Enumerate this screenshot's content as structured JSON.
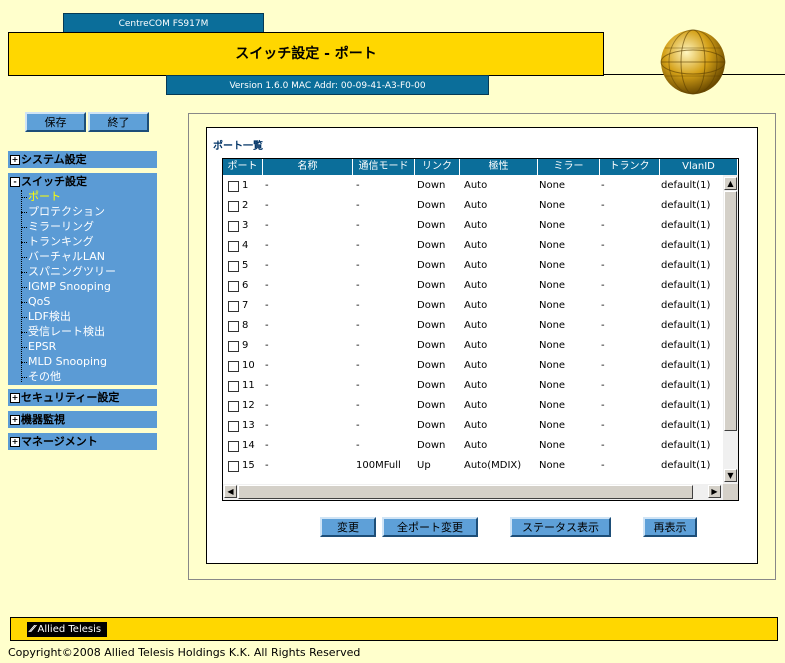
{
  "header": {
    "model": "CentreCOM FS917M",
    "title": "スイッチ設定 - ポート",
    "version": "Version 1.6.0 MAC Addr: 00-09-41-A3-F0-00"
  },
  "actions": {
    "save": "保存",
    "exit": "終了"
  },
  "sidebar": {
    "system": "システム設定",
    "switch": "スイッチ設定",
    "switch_items": [
      "ポート",
      "プロテクション",
      "ミラーリング",
      "トランキング",
      "バーチャルLAN",
      "スパニングツリー",
      "IGMP Snooping",
      "QoS",
      "LDF検出",
      "受信レート検出",
      "EPSR",
      "MLD Snooping",
      "その他"
    ],
    "security": "セキュリティー設定",
    "monitor": "機器監視",
    "management": "マネージメント",
    "expand_glyph": "+",
    "collapse_glyph": "-"
  },
  "port_list": {
    "title": "ポート一覧",
    "columns": [
      "ポート",
      "名称",
      "通信モード",
      "リンク",
      "極性",
      "ミラー",
      "トランク",
      "VlanID"
    ],
    "rows": [
      {
        "port": "1",
        "name": "-",
        "mode": "-",
        "link": "Down",
        "polarity": "Auto",
        "mirror": "None",
        "trunk": "-",
        "vlan": "default(1)"
      },
      {
        "port": "2",
        "name": "-",
        "mode": "-",
        "link": "Down",
        "polarity": "Auto",
        "mirror": "None",
        "trunk": "-",
        "vlan": "default(1)"
      },
      {
        "port": "3",
        "name": "-",
        "mode": "-",
        "link": "Down",
        "polarity": "Auto",
        "mirror": "None",
        "trunk": "-",
        "vlan": "default(1)"
      },
      {
        "port": "4",
        "name": "-",
        "mode": "-",
        "link": "Down",
        "polarity": "Auto",
        "mirror": "None",
        "trunk": "-",
        "vlan": "default(1)"
      },
      {
        "port": "5",
        "name": "-",
        "mode": "-",
        "link": "Down",
        "polarity": "Auto",
        "mirror": "None",
        "trunk": "-",
        "vlan": "default(1)"
      },
      {
        "port": "6",
        "name": "-",
        "mode": "-",
        "link": "Down",
        "polarity": "Auto",
        "mirror": "None",
        "trunk": "-",
        "vlan": "default(1)"
      },
      {
        "port": "7",
        "name": "-",
        "mode": "-",
        "link": "Down",
        "polarity": "Auto",
        "mirror": "None",
        "trunk": "-",
        "vlan": "default(1)"
      },
      {
        "port": "8",
        "name": "-",
        "mode": "-",
        "link": "Down",
        "polarity": "Auto",
        "mirror": "None",
        "trunk": "-",
        "vlan": "default(1)"
      },
      {
        "port": "9",
        "name": "-",
        "mode": "-",
        "link": "Down",
        "polarity": "Auto",
        "mirror": "None",
        "trunk": "-",
        "vlan": "default(1)"
      },
      {
        "port": "10",
        "name": "-",
        "mode": "-",
        "link": "Down",
        "polarity": "Auto",
        "mirror": "None",
        "trunk": "-",
        "vlan": "default(1)"
      },
      {
        "port": "11",
        "name": "-",
        "mode": "-",
        "link": "Down",
        "polarity": "Auto",
        "mirror": "None",
        "trunk": "-",
        "vlan": "default(1)"
      },
      {
        "port": "12",
        "name": "-",
        "mode": "-",
        "link": "Down",
        "polarity": "Auto",
        "mirror": "None",
        "trunk": "-",
        "vlan": "default(1)"
      },
      {
        "port": "13",
        "name": "-",
        "mode": "-",
        "link": "Down",
        "polarity": "Auto",
        "mirror": "None",
        "trunk": "-",
        "vlan": "default(1)"
      },
      {
        "port": "14",
        "name": "-",
        "mode": "-",
        "link": "Down",
        "polarity": "Auto",
        "mirror": "None",
        "trunk": "-",
        "vlan": "default(1)"
      },
      {
        "port": "15",
        "name": "-",
        "mode": "100MFull",
        "link": "Up",
        "polarity": "Auto(MDIX)",
        "mirror": "None",
        "trunk": "-",
        "vlan": "default(1)"
      }
    ]
  },
  "scroll_glyphs": {
    "up": "▲",
    "down": "▼",
    "left": "◀",
    "right": "▶"
  },
  "bottom_buttons": {
    "change": "変更",
    "change_all": "全ポート変更",
    "status": "ステータス表示",
    "refresh": "再表示"
  },
  "footer": {
    "logo": "Allied Telesis",
    "copyright": "Copyright©2008 Allied Telesis Holdings K.K. All Rights Reserved"
  },
  "colors": {
    "accent_gold": "#ffd700",
    "header_blue": "#0b6e9a",
    "nav_blue": "#5b9bd5",
    "background": "#ffffcc",
    "active_nav": "#ffff00"
  }
}
